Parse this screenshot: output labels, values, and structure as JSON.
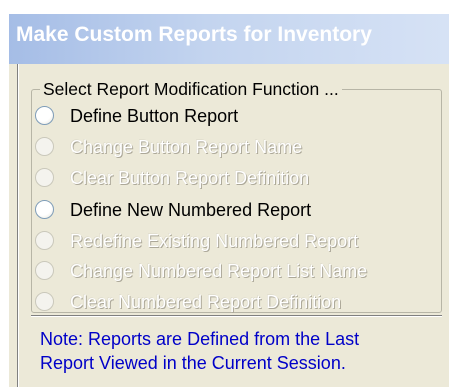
{
  "window": {
    "title": "Make Custom Reports for Inventory"
  },
  "group": {
    "legend": "Select Report Modification Function ..."
  },
  "options": [
    {
      "label": "Define Button Report",
      "enabled": true,
      "selected": false
    },
    {
      "label": "Change Button Report Name",
      "enabled": false,
      "selected": false
    },
    {
      "label": "Clear Button Report Definition",
      "enabled": false,
      "selected": false
    },
    {
      "label": "Define New Numbered Report",
      "enabled": true,
      "selected": false
    },
    {
      "label": "Redefine Existing Numbered Report",
      "enabled": false,
      "selected": false
    },
    {
      "label": "Change Numbered Report List Name",
      "enabled": false,
      "selected": false
    },
    {
      "label": "Clear Numbered Report Definition",
      "enabled": false,
      "selected": false
    }
  ],
  "note": {
    "line1": "Note: Reports are Defined from the Last",
    "line2": "Report Viewed in the Current Session."
  },
  "colors": {
    "title_gradient_start": "#a5bde6",
    "title_gradient_end": "#d6e2f5",
    "panel_bg": "#ece9d8",
    "note_text": "#0000c8"
  }
}
